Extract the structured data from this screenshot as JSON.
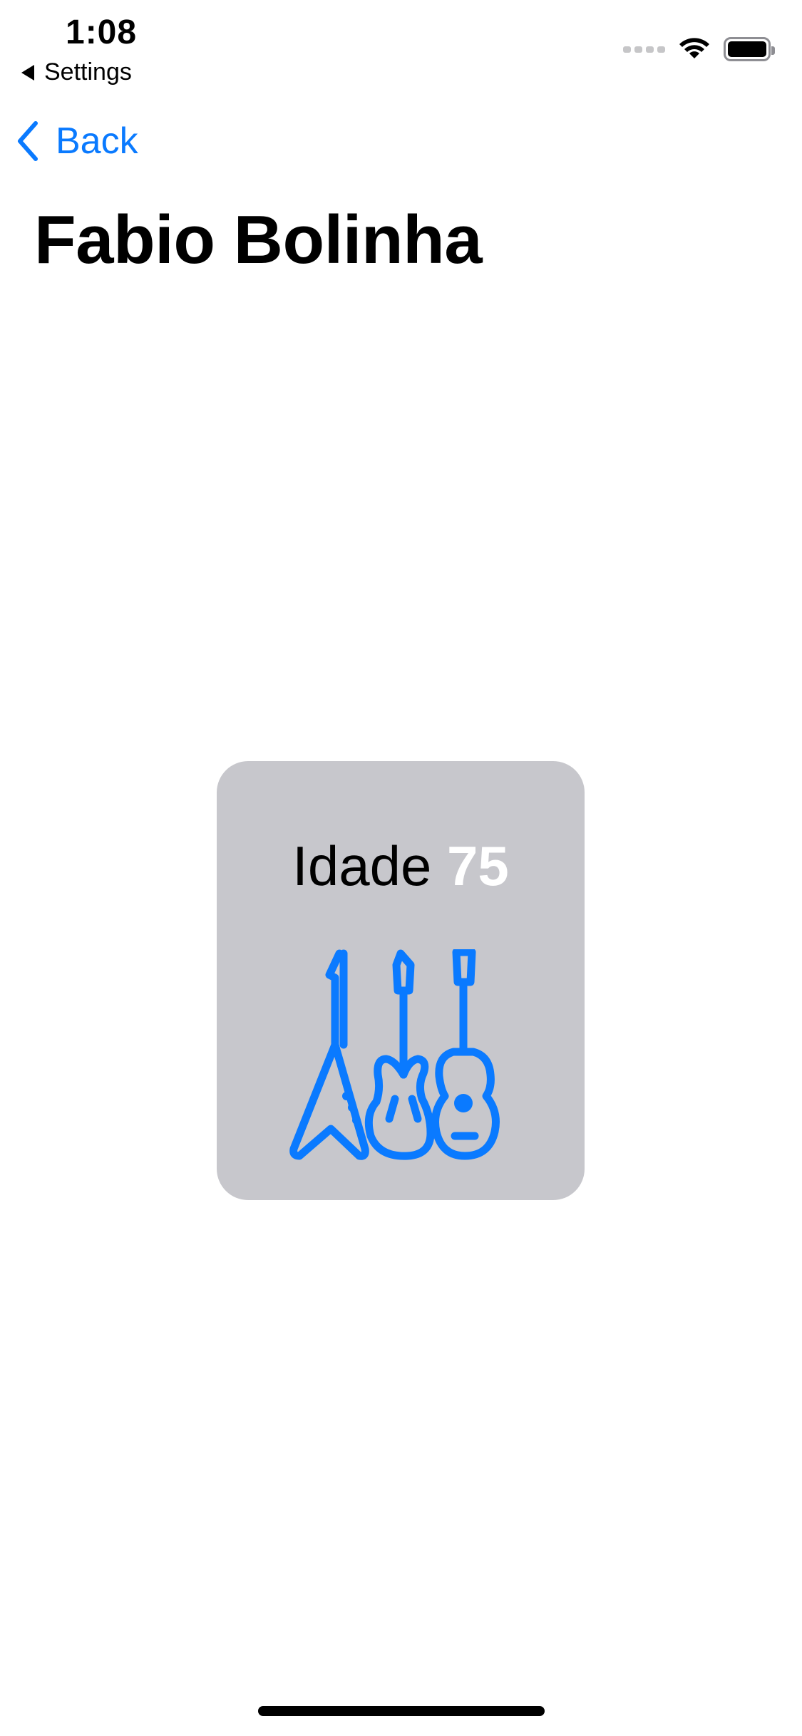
{
  "status_bar": {
    "time": "1:08",
    "back_app": "Settings",
    "wifi_icon": "wifi-icon",
    "battery_icon": "battery-icon"
  },
  "nav": {
    "back_label": "Back",
    "back_icon": "chevron-left-icon"
  },
  "title": "Fabio Bolinha",
  "card": {
    "age_label": "Idade",
    "age_value": "75",
    "icon": "guitars-icon"
  },
  "colors": {
    "accent": "#0a7aff",
    "card_background": "#c7c7cc",
    "background": "#ffffff"
  }
}
